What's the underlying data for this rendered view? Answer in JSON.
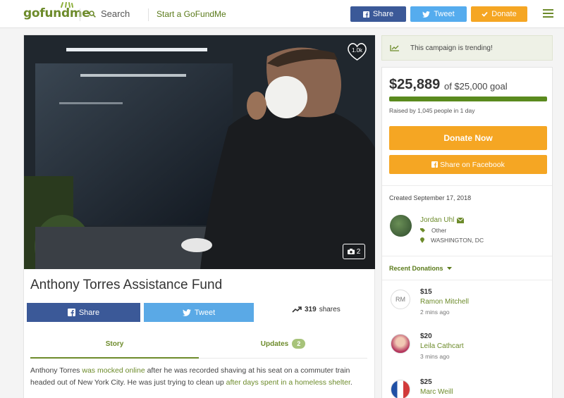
{
  "nav": {
    "logo": "gofundme",
    "search_label": "Search",
    "start_label": "Start a GoFundMe",
    "share_label": "Share",
    "tweet_label": "Tweet",
    "donate_label": "Donate"
  },
  "hero": {
    "heart_count": "1.0k",
    "photo_count": "2"
  },
  "campaign": {
    "title": "Anthony Torres Assistance Fund",
    "share_label": "Share",
    "tweet_label": "Tweet",
    "shares_count": "319",
    "shares_label": "shares",
    "tabs": {
      "story": "Story",
      "updates": "Updates",
      "updates_count": "2"
    },
    "story": {
      "t1": "Anthony Torres ",
      "link1": "was mocked online",
      "t2": "  after he was recorded shaving at his seat on a commuter train headed out of New York City. He was just trying to clean up ",
      "link2": "after days spent in a homeless shelter",
      "t3": "."
    }
  },
  "sidebar": {
    "trending": "This campaign is trending!",
    "amount": "$25,889",
    "goal": "of $25,000 goal",
    "progress": 1.0,
    "raised_text": "Raised by 1,045 people in 1 day",
    "donate_now": "Donate Now",
    "share_facebook": "Share on Facebook",
    "created": "Created September 17, 2018",
    "organizer": {
      "name": "Jordan Uhl",
      "category": "Other",
      "location": "WASHINGTON, DC"
    },
    "recent_label": "Recent Donations",
    "donations": [
      {
        "initials": "RM",
        "amount": "$15",
        "name": "Ramon Mitchell",
        "time": "2 mins ago"
      },
      {
        "initials": "",
        "amount": "$20",
        "name": "Leila Cathcart",
        "time": "3 mins ago"
      },
      {
        "initials": "",
        "amount": "$25",
        "name": "Marc Weill",
        "time": ""
      }
    ]
  },
  "colors": {
    "brand_green": "#6d8b2b",
    "facebook": "#3b5998",
    "twitter": "#55acee",
    "donate_orange": "#f5a623"
  }
}
